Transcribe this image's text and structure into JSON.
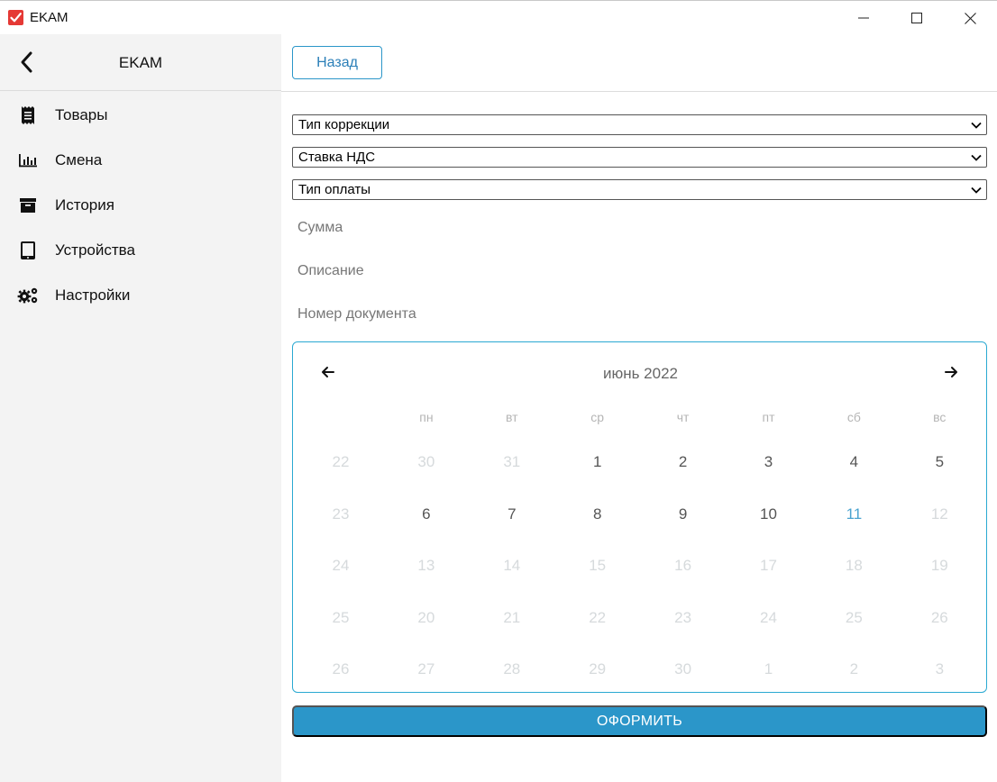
{
  "window": {
    "title": "EKAM",
    "controls": [
      "minimize",
      "maximize",
      "close"
    ]
  },
  "sidebar": {
    "title": "EKAM",
    "items": [
      {
        "label": "Товары",
        "icon": "receipt-icon"
      },
      {
        "label": "Смена",
        "icon": "bar-chart-icon"
      },
      {
        "label": "История",
        "icon": "archive-icon"
      },
      {
        "label": "Устройства",
        "icon": "tablet-icon"
      },
      {
        "label": "Настройки",
        "icon": "gears-icon"
      }
    ]
  },
  "main": {
    "back_label": "Назад",
    "selects": [
      {
        "value": "Тип коррекции"
      },
      {
        "value": "Ставка НДС"
      },
      {
        "value": "Тип оплаты"
      }
    ],
    "fields": {
      "sum_placeholder": "Сумма",
      "description_placeholder": "Описание",
      "doc_number_placeholder": "Номер документа"
    },
    "calendar": {
      "title": "июнь 2022",
      "weekdays": [
        "пн",
        "вт",
        "ср",
        "чт",
        "пт",
        "сб",
        "вс"
      ],
      "weeks": [
        [
          {
            "d": "22",
            "t": "dim"
          },
          {
            "d": "30",
            "t": "dim"
          },
          {
            "d": "31",
            "t": "dim"
          },
          {
            "d": "1",
            "t": "cur"
          },
          {
            "d": "2",
            "t": "cur"
          },
          {
            "d": "3",
            "t": "cur"
          },
          {
            "d": "4",
            "t": "cur"
          },
          {
            "d": "5",
            "t": "cur"
          }
        ],
        [
          {
            "d": "23",
            "t": "dim"
          },
          {
            "d": "6",
            "t": "cur"
          },
          {
            "d": "7",
            "t": "cur"
          },
          {
            "d": "8",
            "t": "cur"
          },
          {
            "d": "9",
            "t": "cur"
          },
          {
            "d": "10",
            "t": "cur"
          },
          {
            "d": "11",
            "t": "today"
          },
          {
            "d": "12",
            "t": "dim"
          }
        ],
        [
          {
            "d": "24",
            "t": "dim"
          },
          {
            "d": "13",
            "t": "dim"
          },
          {
            "d": "14",
            "t": "dim"
          },
          {
            "d": "15",
            "t": "dim"
          },
          {
            "d": "16",
            "t": "dim"
          },
          {
            "d": "17",
            "t": "dim"
          },
          {
            "d": "18",
            "t": "dim"
          },
          {
            "d": "19",
            "t": "dim"
          }
        ],
        [
          {
            "d": "25",
            "t": "dim"
          },
          {
            "d": "20",
            "t": "dim"
          },
          {
            "d": "21",
            "t": "dim"
          },
          {
            "d": "22",
            "t": "dim"
          },
          {
            "d": "23",
            "t": "dim"
          },
          {
            "d": "24",
            "t": "dim"
          },
          {
            "d": "25",
            "t": "dim"
          },
          {
            "d": "26",
            "t": "dim"
          }
        ],
        [
          {
            "d": "26",
            "t": "dim"
          },
          {
            "d": "27",
            "t": "dim"
          },
          {
            "d": "28",
            "t": "dim"
          },
          {
            "d": "29",
            "t": "dim"
          },
          {
            "d": "30",
            "t": "dim"
          },
          {
            "d": "1",
            "t": "dim"
          },
          {
            "d": "2",
            "t": "dim"
          },
          {
            "d": "3",
            "t": "dim"
          }
        ]
      ]
    },
    "submit_label": "ОФОРМИТЬ"
  },
  "colors": {
    "accent": "#2b96c9",
    "calendar_border": "#2aa9d2",
    "today": "#4aa3d0",
    "sidebar_bg": "#f3f3f3",
    "app_icon": "#e53935"
  }
}
